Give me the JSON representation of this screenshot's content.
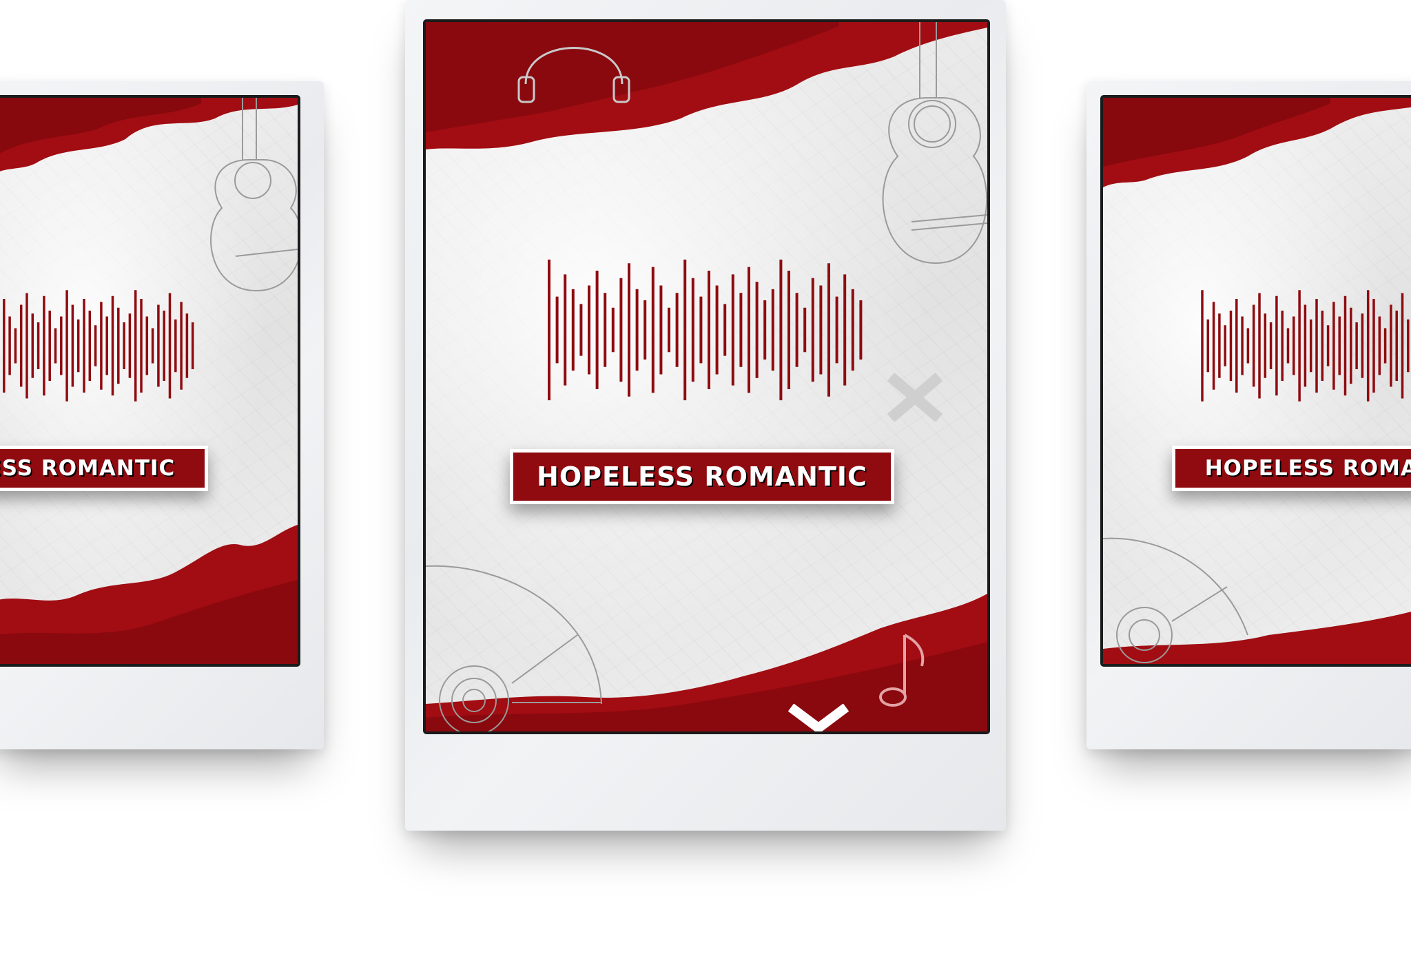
{
  "poster": {
    "title": "HOPELESS ROMANTIC",
    "accent_color": "#8f0b10",
    "paper_color": "#ececec",
    "frame_color": "#1b1b1b",
    "icons": [
      "headphones-icon",
      "guitar-icon",
      "vinyl-disc-icon",
      "music-note-icon",
      "x-mark-icon",
      "chevron-down-icon"
    ]
  },
  "left_poster": {
    "title": "HOPELESS ROMANTIC"
  },
  "center_poster": {
    "title": "HOPELESS ROMANTIC"
  },
  "right_poster": {
    "title": "HOPELESS ROMANTIC"
  }
}
